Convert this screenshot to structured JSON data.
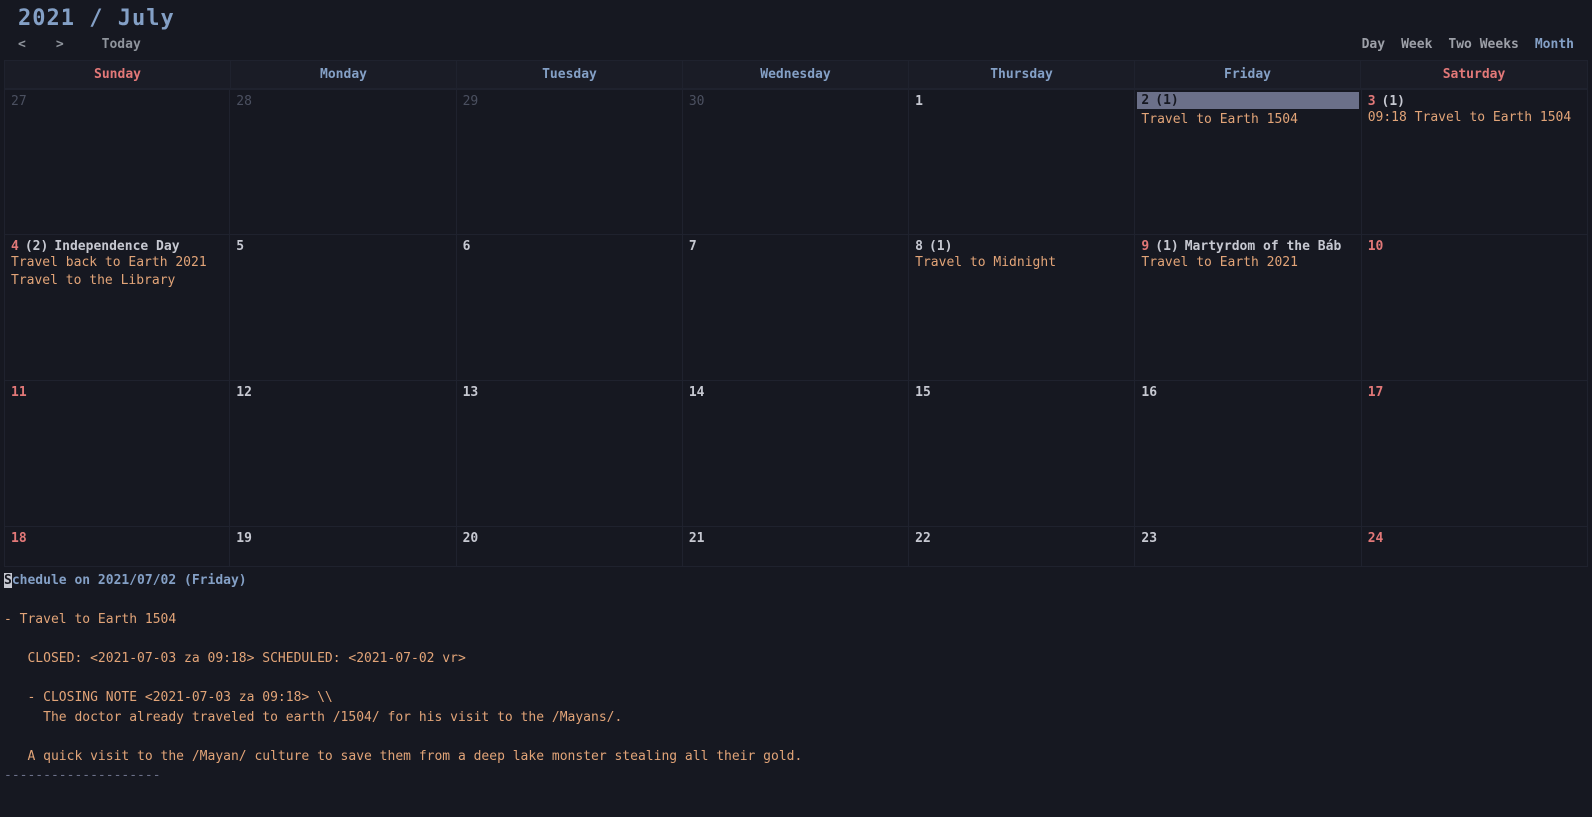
{
  "header": {
    "title": "2021 / July",
    "prev": "<",
    "next": ">",
    "today": "Today"
  },
  "views": {
    "day": "Day",
    "week": "Week",
    "two_weeks": "Two Weeks",
    "month": "Month"
  },
  "daynames": {
    "sun": "Sunday",
    "mon": "Monday",
    "tue": "Tuesday",
    "wed": "Wednesday",
    "thu": "Thursday",
    "fri": "Friday",
    "sat": "Saturday"
  },
  "calendar": {
    "weeks": [
      {
        "days": [
          {
            "num": "27",
            "other": true,
            "weekend": true
          },
          {
            "num": "28",
            "other": true
          },
          {
            "num": "29",
            "other": true
          },
          {
            "num": "30",
            "other": true
          },
          {
            "num": "1",
            "weekday": true
          },
          {
            "num": "2",
            "count": "(1)",
            "today": true,
            "events": [
              "Travel to Earth 1504"
            ]
          },
          {
            "num": "3",
            "count": "(1)",
            "weekend": true,
            "events": [
              "09:18 Travel to Earth 1504"
            ]
          }
        ]
      },
      {
        "days": [
          {
            "num": "4",
            "count": "(2)",
            "weekend": true,
            "holiday": "Independence Day",
            "events": [
              "Travel back to Earth 2021",
              "Travel to the Library"
            ]
          },
          {
            "num": "5"
          },
          {
            "num": "6"
          },
          {
            "num": "7"
          },
          {
            "num": "8",
            "count": "(1)",
            "events": [
              "Travel to Midnight"
            ]
          },
          {
            "num": "9",
            "count": "(1)",
            "weekend": true,
            "holiday": "Martyrdom of the Báb",
            "events": [
              "Travel to Earth 2021"
            ]
          },
          {
            "num": "10",
            "weekend": true
          }
        ]
      },
      {
        "days": [
          {
            "num": "11",
            "weekend": true
          },
          {
            "num": "12"
          },
          {
            "num": "13"
          },
          {
            "num": "14"
          },
          {
            "num": "15"
          },
          {
            "num": "16"
          },
          {
            "num": "17",
            "weekend": true
          }
        ]
      },
      {
        "days": [
          {
            "num": "18",
            "weekend": true
          },
          {
            "num": "19"
          },
          {
            "num": "20"
          },
          {
            "num": "21"
          },
          {
            "num": "22"
          },
          {
            "num": "23"
          },
          {
            "num": "24",
            "weekend": true
          }
        ]
      }
    ]
  },
  "schedule": {
    "title_pre": "S",
    "title_rest": "chedule on 2021/07/02 (Friday)",
    "body": "\n- Travel to Earth 1504\n\n   CLOSED: <2021-07-03 za 09:18> SCHEDULED: <2021-07-02 vr>\n\n   - CLOSING NOTE <2021-07-03 za 09:18> \\\\\n     The doctor already traveled to earth /1504/ for his visit to the /Mayans/.\n\n   A quick visit to the /Mayan/ culture to save them from a deep lake monster stealing all their gold.\n",
    "divider": "--------------------"
  }
}
